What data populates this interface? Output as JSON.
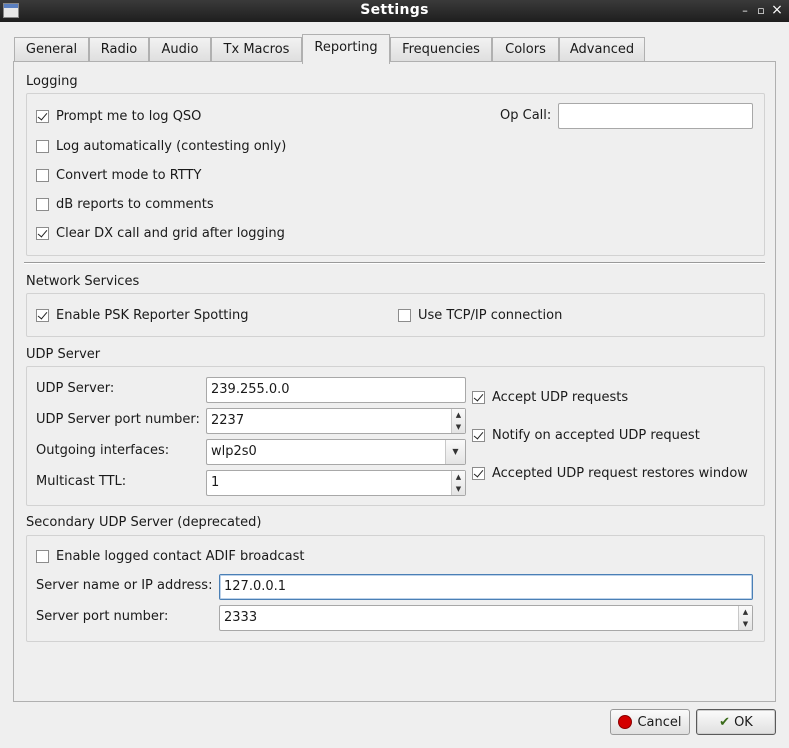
{
  "window": {
    "title": "Settings",
    "minimize": "–",
    "maximize": "▫",
    "close": "×"
  },
  "tabs": [
    {
      "label": "General"
    },
    {
      "label": "Radio"
    },
    {
      "label": "Audio"
    },
    {
      "label": "Tx Macros"
    },
    {
      "label": "Reporting"
    },
    {
      "label": "Frequencies"
    },
    {
      "label": "Colors"
    },
    {
      "label": "Advanced"
    }
  ],
  "active_tab": "Reporting",
  "logging": {
    "title": "Logging",
    "prompt_log": {
      "label": "Prompt me to log QSO",
      "checked": true
    },
    "log_auto": {
      "label": "Log automatically (contesting only)",
      "checked": false
    },
    "convert_rtty": {
      "label": "Convert mode to RTTY",
      "checked": false
    },
    "db_reports": {
      "label": "dB reports to comments",
      "checked": false
    },
    "clear_dx": {
      "label": "Clear DX call and grid after logging",
      "checked": true
    },
    "op_call_label": "Op Call:",
    "op_call_value": ""
  },
  "network": {
    "title": "Network Services",
    "psk": {
      "label": "Enable PSK Reporter Spotting",
      "checked": true
    },
    "tcpip": {
      "label": "Use TCP/IP connection",
      "checked": false
    }
  },
  "udp": {
    "title": "UDP Server",
    "server_label": "UDP Server:",
    "server_value": "239.255.0.0",
    "port_label": "UDP Server port number:",
    "port_value": "2237",
    "iface_label": "Outgoing interfaces:",
    "iface_value": "wlp2s0",
    "ttl_label": "Multicast TTL:",
    "ttl_value": "1",
    "accept": {
      "label": "Accept UDP requests",
      "checked": true
    },
    "notify": {
      "label": "Notify on accepted UDP request",
      "checked": true
    },
    "restore": {
      "label": "Accepted UDP request restores window",
      "checked": true
    }
  },
  "secondary": {
    "title": "Secondary UDP Server (deprecated)",
    "adif": {
      "label": "Enable logged contact ADIF broadcast",
      "checked": false
    },
    "server_label": "Server name or IP address:",
    "server_value": "127.0.0.1",
    "port_label": "Server port number:",
    "port_value": "2333"
  },
  "buttons": {
    "cancel": "Cancel",
    "ok": "OK"
  },
  "icons": {
    "cancel": "cancel-icon",
    "ok": "ok-icon"
  }
}
